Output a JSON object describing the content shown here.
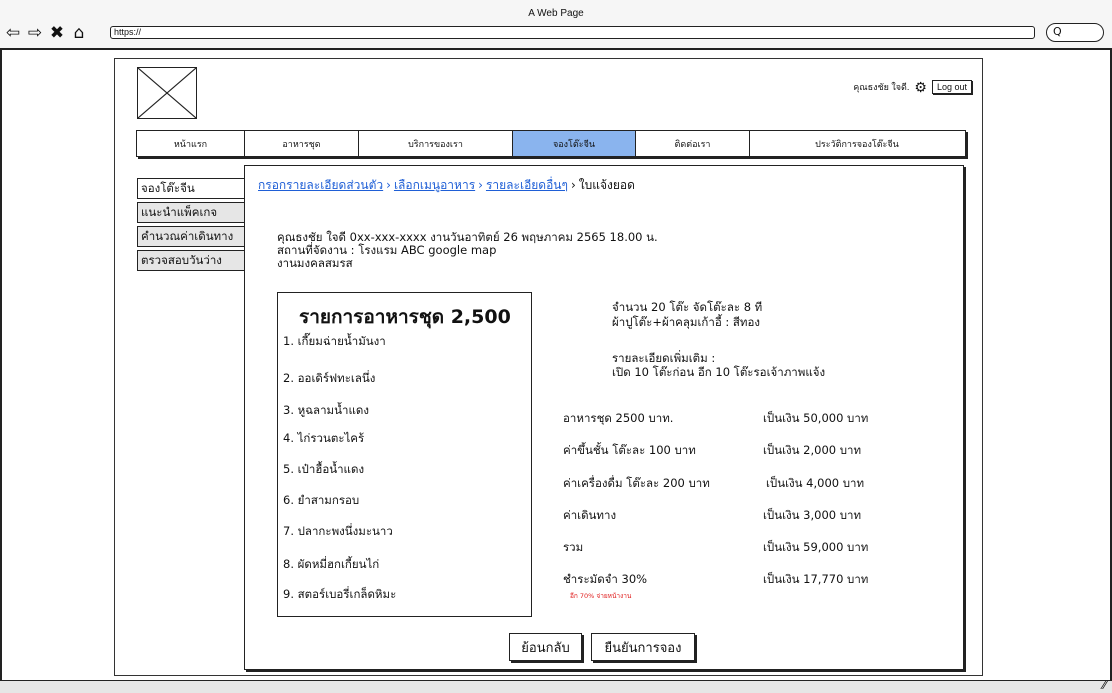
{
  "browser": {
    "title": "A Web Page",
    "url": "https://",
    "search_placeholder": "Q"
  },
  "header": {
    "user_name": "คุณธงชัย ใจดี.",
    "logout_label": "Log out"
  },
  "nav": {
    "tabs": [
      {
        "label": "หน้าแรก"
      },
      {
        "label": "อาหารชุด"
      },
      {
        "label": "บริการของเรา"
      },
      {
        "label": "จองโต๊ะจีน"
      },
      {
        "label": "ติดต่อเรา"
      },
      {
        "label": "ประวัติการจองโต๊ะจีน"
      }
    ]
  },
  "sidebar": {
    "items": [
      {
        "label": "จองโต๊ะจีน"
      },
      {
        "label": "แนะนำแพ็คเกจ"
      },
      {
        "label": "คำนวณค่าเดินทาง"
      },
      {
        "label": "ตรวจสอบวันว่าง"
      }
    ]
  },
  "breadcrumb": {
    "step1": "กรอกรายละเอียดส่วนตัว",
    "step2": "เลือกเมนูอาหาร",
    "step3": "รายละเอียดอื่นๆ",
    "current": "ใบแจ้งยอด",
    "separator": "›"
  },
  "info": {
    "line1": "คุณธงชัย ใจดี 0xx-xxx-xxxx งานวันอาทิตย์ 26 พฤษภาคม 2565 18.00 น.",
    "line2": "สถานที่จัดงาน : โรงแรม ABC google map",
    "line3": "งานมงคลสมรส"
  },
  "menu": {
    "title": "รายการอาหารชุด 2,500",
    "items": [
      "1. เกี๊ยมฉ่ายน้ำมันงา",
      "2. ออเดิร์ฟทะเลนึ่ง",
      "3. หูฉลามน้ำแดง",
      "4. ไก่รวนตะไคร้",
      "5. เป๋าฮื้อน้ำแดง",
      "6. ยำสามกรอบ",
      "7. ปลากะพงนึ่งมะนาว",
      "8. ผัดหมี่ฮกเกี้ยนไก่",
      "9. สตอร์เบอรี่เกล็ดหิมะ"
    ]
  },
  "details": {
    "tables": "จำนวน 20 โต๊ะ จัดโต๊ะละ 8 ที",
    "cloth": "ผ้าปูโต๊ะ+ผ้าคลุมเก้าอี้ : สีทอง",
    "more_label": "รายละเอียดเพิ่มเติม :",
    "more_text": "เปิด 10 โต๊ะก่อน อีก 10 โต๊ะรอเจ้าภาพแจ้ง"
  },
  "costs": [
    {
      "label": "อาหารชุด 2500 บาท.",
      "value": "เป็นเงิน 50,000 บาท"
    },
    {
      "label": "ค่าขึ้นชั้น โต๊ะละ 100 บาท",
      "value": "เป็นเงิน 2,000 บาท"
    },
    {
      "label": "ค่าเครื่องดื่ม โต๊ะละ 200 บาท",
      "value": "เป็นเงิน 4,000 บาท"
    },
    {
      "label": "ค่าเดินทาง",
      "value": "เป็นเงิน 3,000 บาท"
    },
    {
      "label": "รวม",
      "value": "เป็นเงิน 59,000 บาท"
    },
    {
      "label": "ชำระมัดจำ 30%",
      "value": "เป็นเงิน 17,770 บาท"
    }
  ],
  "deposit_note": "อีก 70% จ่ายหน้างาน",
  "buttons": {
    "back": "ย้อนกลับ",
    "confirm": "ยืนยันการจอง"
  },
  "colors": {
    "active_tab": "#8ab4ee",
    "link": "#1f5fd6",
    "note_red": "#e02020"
  }
}
